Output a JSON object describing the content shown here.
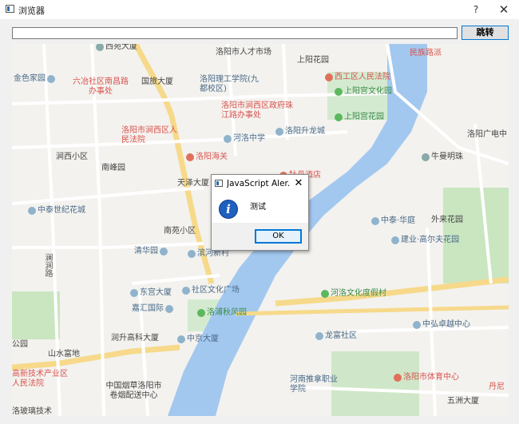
{
  "window": {
    "title": "浏览器",
    "help": "?",
    "close": "✕"
  },
  "toolbar": {
    "url_value": "",
    "go_label": "跳转"
  },
  "map": {
    "pois": [
      {
        "text": "西苑大厦",
        "type": "gray"
      },
      {
        "text": "洛阳市人才市场",
        "type": "gray"
      },
      {
        "text": "上阳花园",
        "type": "gray"
      },
      {
        "text": "金色家园",
        "type": "area"
      },
      {
        "text": "六冶社区南昌路办事处",
        "type": "gov"
      },
      {
        "text": "国旅大厦",
        "type": "gray"
      },
      {
        "text": "洛阳理工学院(九都校区)",
        "type": "area"
      },
      {
        "text": "西工区人民法院",
        "type": "gov"
      },
      {
        "text": "上阳宫文化园",
        "type": "park"
      },
      {
        "text": "洛阳市涧西区政府珠江路办事处",
        "type": "gov"
      },
      {
        "text": "上阳宫花园",
        "type": "park"
      },
      {
        "text": "洛阳市涧西区人民法院",
        "type": "gov"
      },
      {
        "text": "河洛中学",
        "type": "area"
      },
      {
        "text": "洛阳升龙城",
        "type": "area"
      },
      {
        "text": "洛阳广电中",
        "type": "gray"
      },
      {
        "text": "涧西小区",
        "type": "gray"
      },
      {
        "text": "洛阳海关",
        "type": "gov"
      },
      {
        "text": "南峰园",
        "type": "gray"
      },
      {
        "text": "牛曼明珠",
        "type": "gray"
      },
      {
        "text": "天泽大厦",
        "type": "gray"
      },
      {
        "text": "中泰世纪花城",
        "type": "area"
      },
      {
        "text": "中泰·华庭",
        "type": "area"
      },
      {
        "text": "外来花园",
        "type": "gray"
      },
      {
        "text": "南苑小区",
        "type": "gray"
      },
      {
        "text": "建业·高尔夫花园",
        "type": "area"
      },
      {
        "text": "清华园",
        "type": "area"
      },
      {
        "text": "滨河新村",
        "type": "area"
      },
      {
        "text": "东宫大厦",
        "type": "area"
      },
      {
        "text": "社区文化广场",
        "type": "area"
      },
      {
        "text": "河洛文化度假村",
        "type": "park"
      },
      {
        "text": "嘉汇国际",
        "type": "area"
      },
      {
        "text": "洛浦秋风园",
        "type": "park"
      },
      {
        "text": "中弘卓越中心",
        "type": "area"
      },
      {
        "text": "润升高科大厦",
        "type": "gray"
      },
      {
        "text": "中京大厦",
        "type": "area"
      },
      {
        "text": "龙富社区",
        "type": "area"
      },
      {
        "text": "山水富地",
        "type": "gray"
      },
      {
        "text": "公园",
        "type": "gray"
      },
      {
        "text": "洛阳市体育中心",
        "type": "gov"
      },
      {
        "text": "高新技术产业区人民法院",
        "type": "gov"
      },
      {
        "text": "中国烟草洛阳市卷烟配送中心",
        "type": "gray"
      },
      {
        "text": "河南推拿职业学院",
        "type": "area"
      },
      {
        "text": "五洲大厦",
        "type": "gray"
      },
      {
        "text": "丹尼",
        "type": "gov"
      },
      {
        "text": "洛玻璃技术",
        "type": "gray"
      },
      {
        "text": "牡丹酒店",
        "type": "gov"
      },
      {
        "text": "民族路派",
        "type": "gov"
      },
      {
        "text": "澜涧路",
        "type": "gray"
      }
    ]
  },
  "alert": {
    "title": "JavaScript Aler...",
    "close": "✕",
    "icon": "info-icon",
    "message": "测试",
    "ok_label": "OK"
  },
  "colors": {
    "water": "#a3c8f0",
    "road_major": "#f6d98a",
    "park": "#c9e6c0",
    "button_border": "#0078d7"
  }
}
